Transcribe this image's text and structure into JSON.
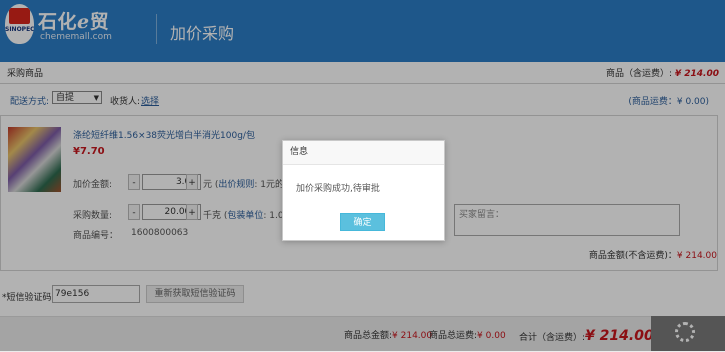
{
  "header": {
    "logo_mark_text": "SINOPEC",
    "logo_name_pre": "石化",
    "logo_name_e": "e",
    "logo_name_post": "贸",
    "logo_url": "chememall.com",
    "page_title": "加价采购"
  },
  "section": {
    "title": "采购商品",
    "total_label": "商品（含运费）:",
    "total_value": "¥ 214.00"
  },
  "delivery": {
    "label": "配送方式:",
    "selected": "自提",
    "receiver_label": "收货人:",
    "receiver_link": "选择",
    "shipping_fee": "(商品运费：¥ 0.00)"
  },
  "product": {
    "name": "涤纶短纤维1.56×38荧光增白半消光100g/包",
    "price": "¥7.70",
    "markup_label": "加价金额:",
    "markup_value": "3.00",
    "markup_unit": "元 (",
    "markup_rule_link": "出价规则",
    "markup_rule_suffix": ": 1元的",
    "qty_label": "采购数量:",
    "qty_value": "20.000",
    "qty_unit": "千克 (",
    "pack_unit_link": "包装单位",
    "pack_unit_suffix": ": 1.0",
    "code_label": "商品编号：",
    "code_value": "1600800063",
    "buyer_msg_placeholder": "买家留言：",
    "amount_label": "商品金额(不含运费)：",
    "amount_value": "¥ 214.00",
    "minus": "-",
    "plus": "+"
  },
  "sms": {
    "label": "*短信验证码：",
    "value": "79e156",
    "resend_button": "重新获取短信验证码"
  },
  "footer": {
    "goods_total_label": "商品总金额:",
    "goods_total_value": "¥ 214.00",
    "shipping_total_label": "商品总运费:",
    "shipping_total_value": "¥ 0.00",
    "grand_total_label": "合计（含运费）:",
    "grand_total_value": "¥ 214.00"
  },
  "dialog": {
    "title": "信息",
    "message": "加价采购成功,待审批",
    "confirm_button": "确定"
  },
  "colors": {
    "header_blue": "#2c7dc6",
    "price_red": "#c8161d",
    "link_blue": "#2c5e9b",
    "confirm_button": "#5bc0de"
  }
}
